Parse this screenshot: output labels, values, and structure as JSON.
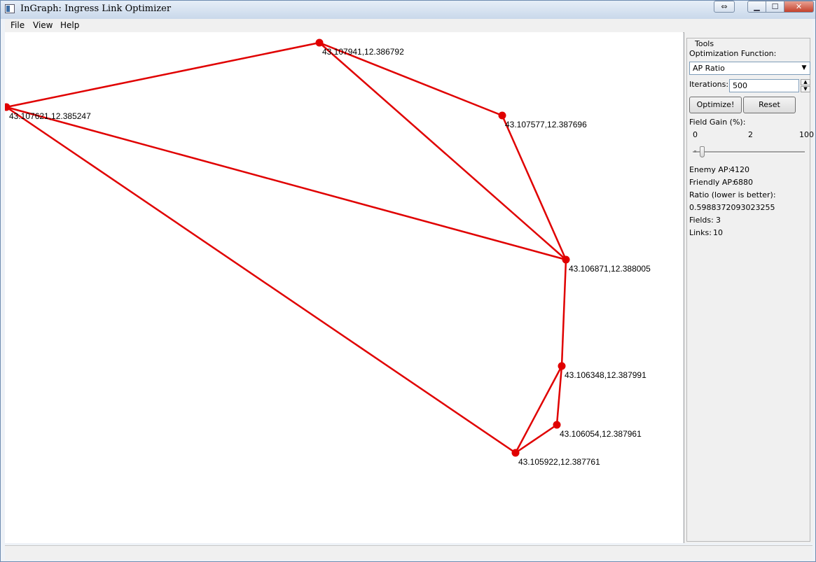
{
  "window": {
    "title": "InGraph: Ingress Link Optimizer"
  },
  "menu": {
    "file": "File",
    "view": "View",
    "help": "Help"
  },
  "map": {
    "line_color": "#e00000",
    "portals": [
      {
        "label": "43.107941,12.386792"
      },
      {
        "label": "43.107621,12.385247"
      },
      {
        "label": "43.107577,12.387696"
      },
      {
        "label": "43.106871,12.388005"
      },
      {
        "label": "43.106348,12.387991"
      },
      {
        "label": "43.106054,12.387961"
      },
      {
        "label": "43.105922,12.387761"
      }
    ],
    "links": [
      [
        0,
        1
      ],
      [
        0,
        2
      ],
      [
        0,
        3
      ],
      [
        2,
        3
      ],
      [
        1,
        3
      ],
      [
        1,
        6
      ],
      [
        3,
        4
      ],
      [
        4,
        6
      ],
      [
        4,
        5
      ],
      [
        5,
        6
      ]
    ]
  },
  "tools": {
    "group_title": "Tools",
    "opt_function_label": "Optimization Function:",
    "opt_function_value": "AP Ratio",
    "iterations_label": "Iterations:",
    "iterations_value": "500",
    "optimize_button": "Optimize!",
    "reset_button": "Reset",
    "field_gain_label": "Field Gain (%):",
    "slider_min": "0",
    "slider_current": "2",
    "slider_max": "100",
    "enemy_ap_label": "Enemy AP:",
    "enemy_ap_value": "4120",
    "friendly_ap_label": "Friendly AP:",
    "friendly_ap_value": "6880",
    "ratio_label": "Ratio (lower is better):",
    "ratio_value": "0.5988372093023255",
    "fields_label": "Fields:",
    "fields_value": "3",
    "links_label": "Links:",
    "links_value": "10"
  }
}
